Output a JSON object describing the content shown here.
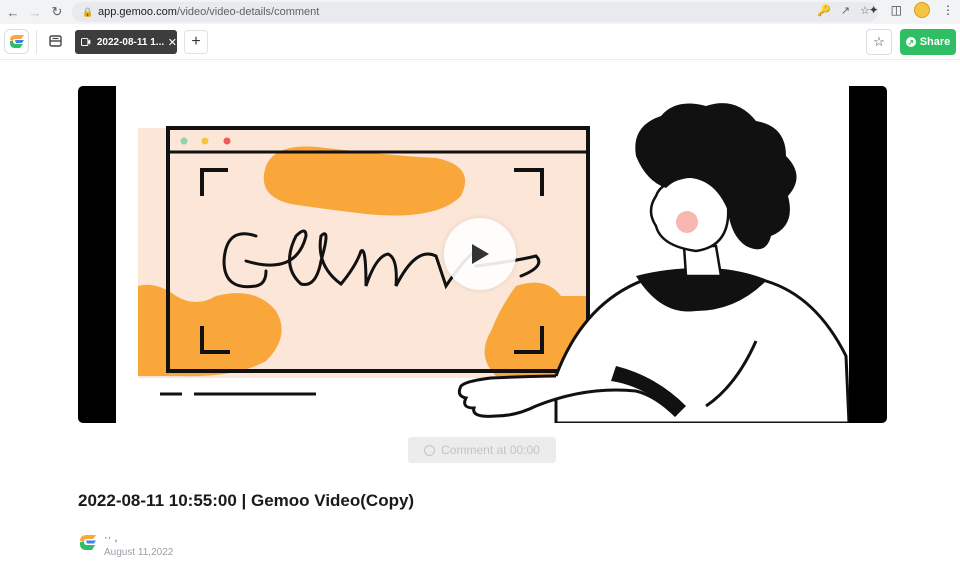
{
  "browser": {
    "url_host": "app.gemoo.com",
    "url_path": "/video/video-details/comment"
  },
  "toolbar": {
    "tab_label": "2022-08-11 1...",
    "new_tab_symbol": "+",
    "share_label": "Share"
  },
  "video": {
    "comment_button_label": "Comment at 00:00",
    "thumbnail_text": "Gemoo"
  },
  "details": {
    "title": "2022-08-11 10:55:00 | Gemoo Video(Copy)",
    "author_name": "·· ,",
    "date": "August 11,2022"
  },
  "colors": {
    "accent_green": "#2fbe63",
    "illustration_orange": "#f9a63a",
    "illustration_peach": "#fbe6d8",
    "dark_tab": "#3d3d3d"
  }
}
